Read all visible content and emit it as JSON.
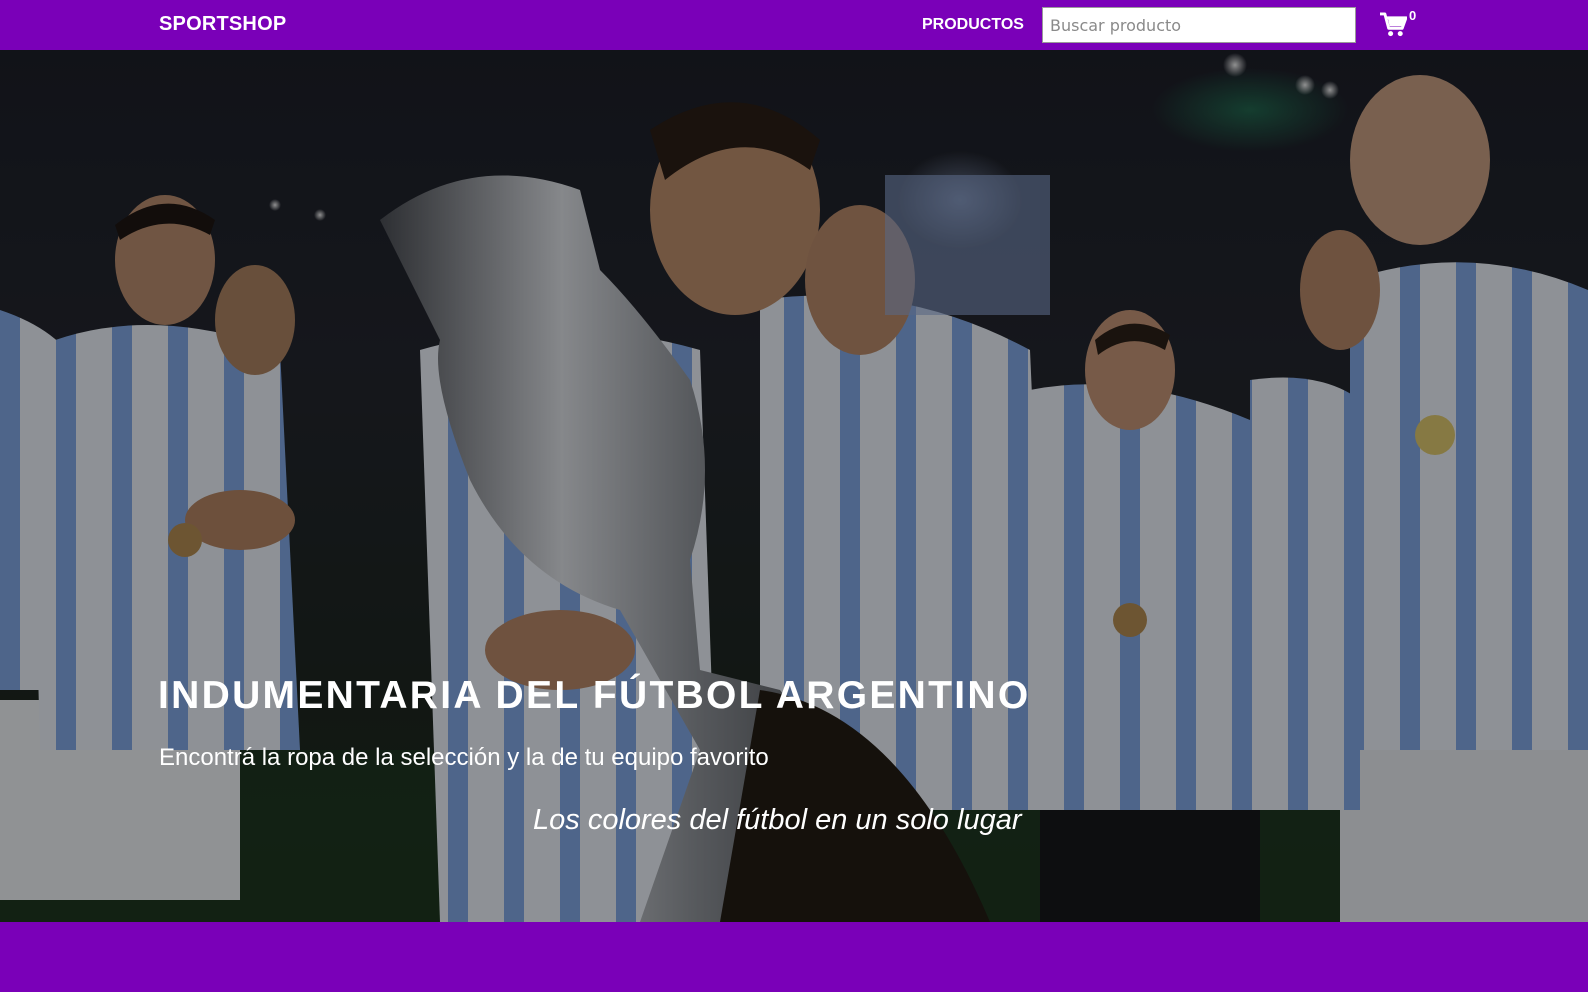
{
  "navbar": {
    "brand": "SPORTSHOP",
    "products_link": "PRODUCTOS",
    "search_placeholder": "Buscar producto",
    "cart_count": "0",
    "cart_icon": "shopping-cart-icon"
  },
  "hero": {
    "title": "INDUMENTARIA DEL FÚTBOL ARGENTINO",
    "subtitle": "Encontrá la ropa de la selección y la de tu equipo favorito",
    "tagline": "Los colores del fútbol en un solo lugar"
  },
  "colors": {
    "brand_purple": "#7a00b8",
    "text_white": "#ffffff"
  }
}
